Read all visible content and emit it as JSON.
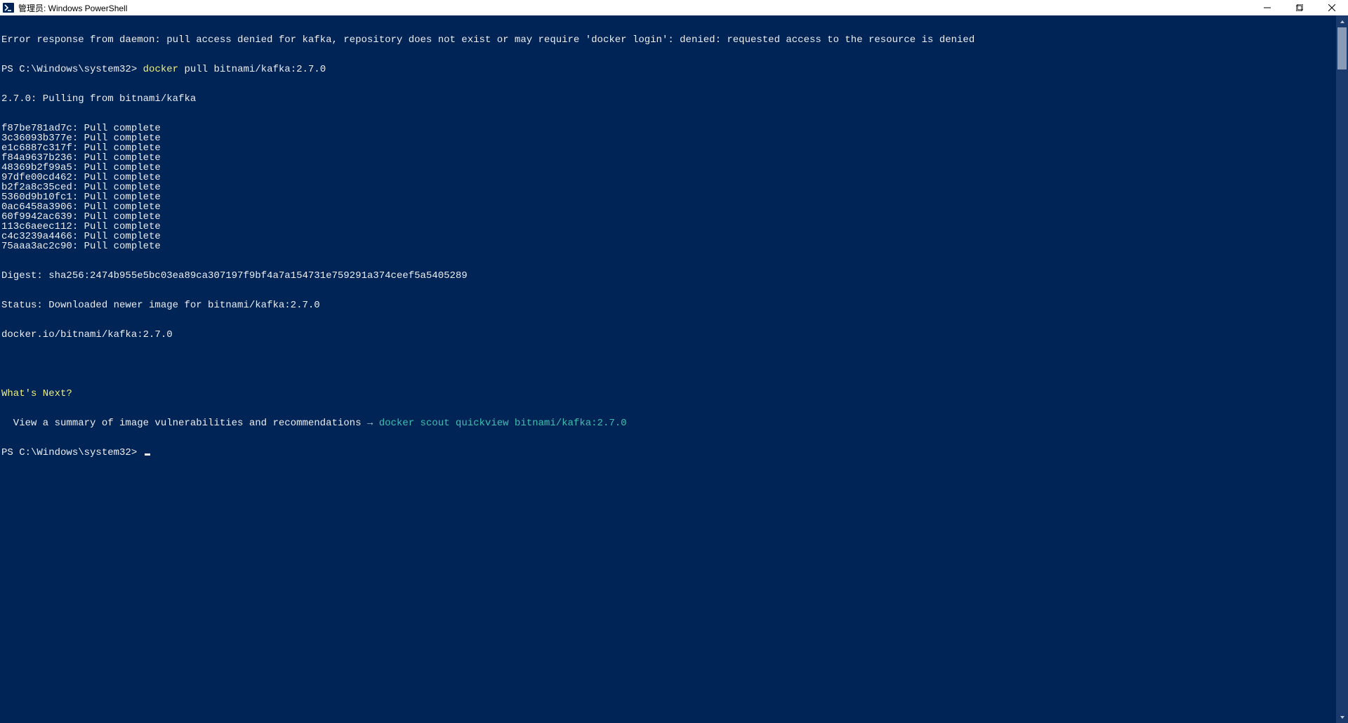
{
  "window": {
    "title": "管理员: Windows PowerShell"
  },
  "terminal": {
    "error_line": "Error response from daemon: pull access denied for kafka, repository does not exist or may require 'docker login': denied: requested access to the resource is denied",
    "prompt1_prefix": "PS C:\\Windows\\system32> ",
    "prompt1_cmd_highlight": "docker",
    "prompt1_cmd_rest": " pull bitnami/kafka:2.7.0",
    "pulling_line": "2.7.0: Pulling from bitnami/kafka",
    "layers": [
      "f87be781ad7c: Pull complete",
      "3c36093b377e: Pull complete",
      "e1c6887c317f: Pull complete",
      "f84a9637b236: Pull complete",
      "48369b2f99a5: Pull complete",
      "97dfe00cd462: Pull complete",
      "b2f2a8c35ced: Pull complete",
      "5360d9b10fc1: Pull complete",
      "0ac6458a3906: Pull complete",
      "60f9942ac639: Pull complete",
      "113c6aeec112: Pull complete",
      "c4c3239a4466: Pull complete",
      "75aaa3ac2c90: Pull complete"
    ],
    "digest_line": "Digest: sha256:2474b955e5bc03ea89ca307197f9bf4a7a154731e759291a374ceef5a5405289",
    "status_line": "Status: Downloaded newer image for bitnami/kafka:2.7.0",
    "image_ref_line": "docker.io/bitnami/kafka:2.7.0",
    "whats_next": "What's Next?",
    "summary_prefix": "  View a summary of image vulnerabilities and recommendations ",
    "summary_arrow": "→",
    "summary_cmd": " docker scout quickview bitnami/kafka:2.7.0",
    "prompt2": "PS C:\\Windows\\system32> "
  }
}
